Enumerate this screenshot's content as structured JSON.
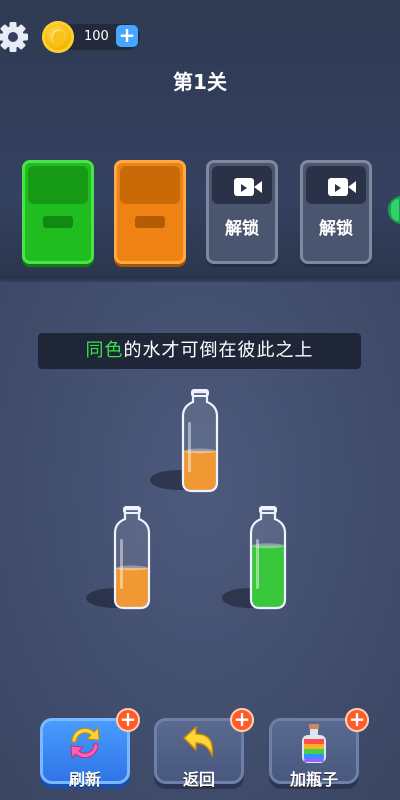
{
  "header": {
    "coins": "100",
    "level_title": "第1关"
  },
  "slots": [
    {
      "state": "green",
      "color": "#1fbd1f"
    },
    {
      "state": "orange",
      "color": "#ee8212"
    },
    {
      "state": "locked",
      "label": "解锁"
    },
    {
      "state": "locked",
      "label": "解锁"
    }
  ],
  "hint": {
    "highlight": "同色",
    "rest": "的水才可倒在彼此之上"
  },
  "bottles": [
    {
      "liquid": "orange",
      "color": "#f28c18",
      "fill_fraction": 0.5
    },
    {
      "liquid": "orange",
      "color": "#f28c18",
      "fill_fraction": 0.5
    },
    {
      "liquid": "green",
      "color": "#22c322",
      "fill_fraction": 0.8
    }
  ],
  "tools": {
    "refresh_label": "刷新",
    "undo_label": "返回",
    "add_bottle_label": "加瓶子",
    "badge_symbol": "+"
  },
  "icons": {
    "settings": "gear-icon",
    "coin": "coin-icon",
    "add_coins": "plus-icon",
    "video": "video-camera-icon",
    "refresh": "refresh-arrows-icon",
    "undo": "undo-arrow-icon",
    "add_bottle": "rainbow-bottle-icon"
  }
}
